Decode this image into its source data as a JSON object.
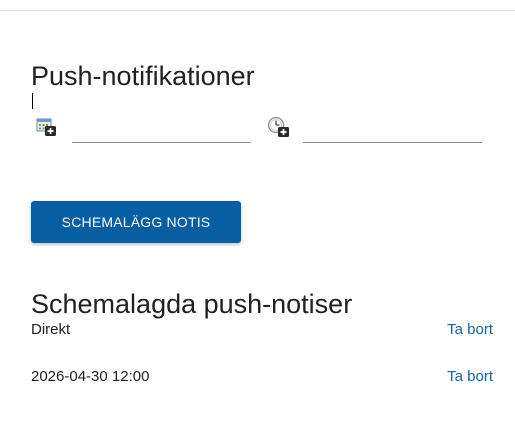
{
  "page": {
    "title": "Push-notifikationer"
  },
  "form": {
    "date_icon": "calendar-add-icon",
    "time_icon": "clock-add-icon",
    "date_value": "",
    "time_value": "",
    "schedule_button": "SCHEMALÄGG NOTIS"
  },
  "scheduled": {
    "title": "Schemalagda push-notiser",
    "items": [
      {
        "label": "Direkt",
        "remove_label": "Ta bort"
      },
      {
        "label": "2026-04-30 12:00",
        "remove_label": "Ta bort"
      }
    ]
  },
  "colors": {
    "primary_button": "#075ea3",
    "link": "#1565a8",
    "text": "#212121"
  }
}
